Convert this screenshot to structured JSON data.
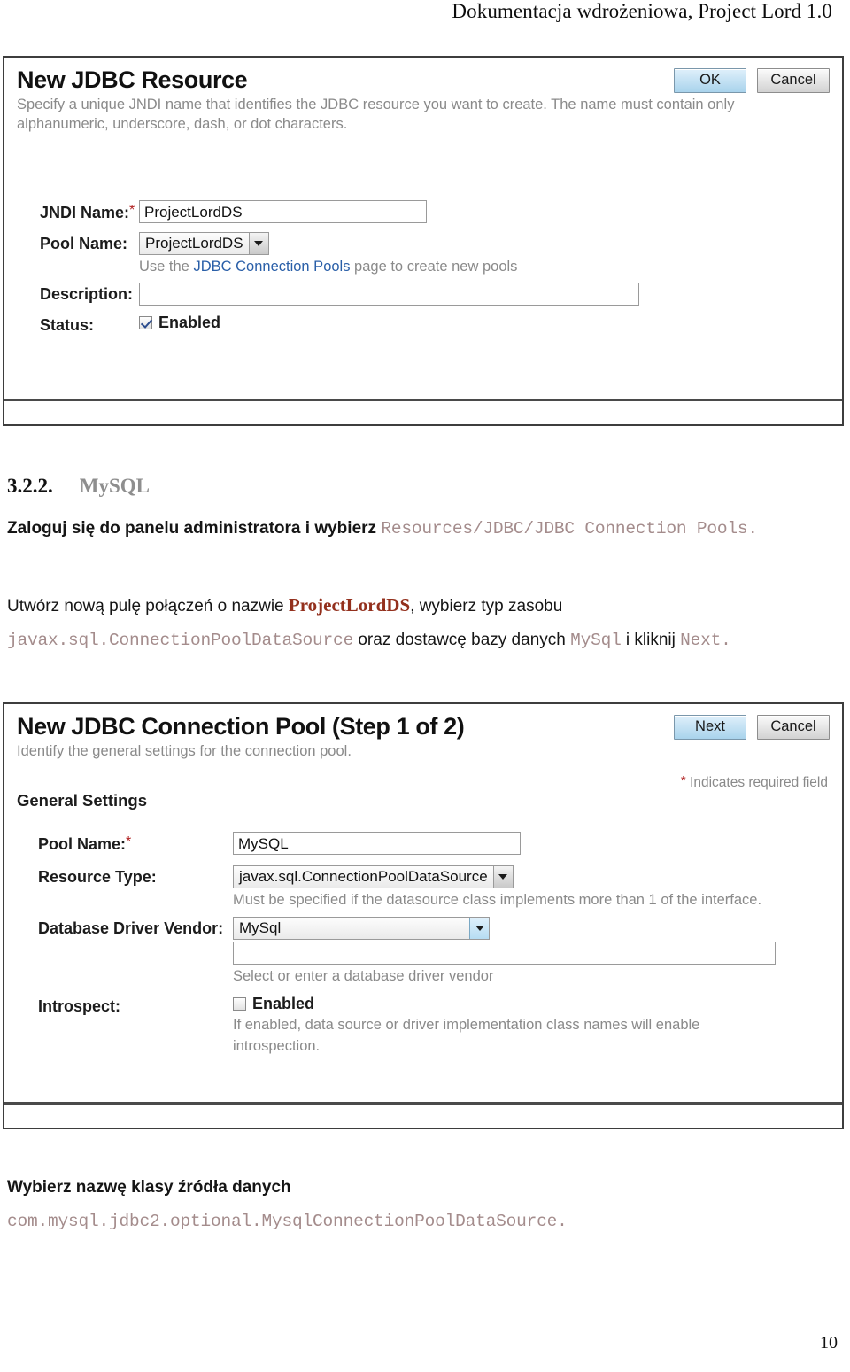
{
  "document": {
    "running_header": "Dokumentacja wdrożeniowa, Project Lord 1.0",
    "page_number": "10"
  },
  "jdbc_resource_panel": {
    "title": "New JDBC Resource",
    "subtitle": "Specify a unique JNDI name that identifies the JDBC resource you want to create. The name must contain only alphanumeric, underscore, dash, or dot characters.",
    "buttons": {
      "ok": "OK",
      "cancel": "Cancel"
    },
    "fields": {
      "jndi_name_label": "JNDI Name:",
      "jndi_name_required": "*",
      "jndi_name_value": "ProjectLordDS",
      "pool_name_label": "Pool Name:",
      "pool_name_value": "ProjectLordDS",
      "pool_name_hint_pre": "Use the ",
      "pool_name_hint_link": "JDBC Connection Pools",
      "pool_name_hint_post": " page to create new pools",
      "description_label": "Description:",
      "description_value": "",
      "status_label": "Status:",
      "status_checkbox_label": "Enabled",
      "status_checked": true
    }
  },
  "section": {
    "number": "3.2.2.",
    "title": "MySQL",
    "paragraph1": {
      "text_1": "Zaloguj się do panelu administratora i wybierz ",
      "code_1": "Resources/JDBC/JDBC Connection Pools."
    },
    "paragraph2": {
      "text_1": "Utwórz nową pulę połączeń o nazwie ",
      "strong_1": "ProjectLordDS",
      "text_2": ", wybierz typ zasobu ",
      "code_1": "javax.sql.ConnectionPoolDataSource",
      "text_3": " oraz dostawcę bazy danych ",
      "code_2": "MySql",
      "text_4": " i kliknij ",
      "code_3": "Next."
    },
    "paragraph3": {
      "text_1": "Wybierz nazwę klasy źródła danych",
      "code_1": "com.mysql.jdbc2.optional.MysqlConnectionPoolDataSource."
    }
  },
  "connection_pool_panel": {
    "title": "New JDBC Connection Pool (Step 1 of 2)",
    "subtitle": "Identify the general settings for the connection pool.",
    "required_note_star": "*",
    "required_note": "Indicates required field",
    "buttons": {
      "next": "Next",
      "cancel": "Cancel"
    },
    "group_title": "General Settings",
    "fields": {
      "pool_name_label": "Pool Name:",
      "pool_name_required": "*",
      "pool_name_value": "MySQL",
      "resource_type_label": "Resource Type:",
      "resource_type_value": "javax.sql.ConnectionPoolDataSource",
      "resource_type_hint": "Must be specified if the datasource class implements more than 1 of the interface.",
      "vendor_label": "Database Driver Vendor:",
      "vendor_value": "MySql",
      "vendor_text_value": "",
      "vendor_hint": "Select or enter a database driver vendor",
      "introspect_label": "Introspect:",
      "introspect_checkbox_label": "Enabled",
      "introspect_checked": false,
      "introspect_hint": "If enabled, data source or driver implementation class names will enable introspection."
    }
  },
  "colors": {
    "code_text": "#a48c8c",
    "strong_red": "#93301d",
    "required_star": "#b02020",
    "link_blue": "#2a5fa8",
    "heading_grey": "#8e8e8e"
  }
}
